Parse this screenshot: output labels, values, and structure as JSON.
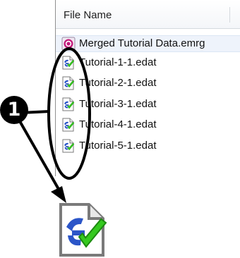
{
  "file_list": {
    "header": "File Name",
    "rows": [
      {
        "name": "Merged Tutorial Data.emrg",
        "icon": "merged-data-icon"
      },
      {
        "name": "Tutorial-1-1.edat",
        "icon": "edat-file-icon"
      },
      {
        "name": "Tutorial-2-1.edat",
        "icon": "edat-file-icon"
      },
      {
        "name": "Tutorial-3-1.edat",
        "icon": "edat-file-icon"
      },
      {
        "name": "Tutorial-4-1.edat",
        "icon": "edat-file-icon"
      },
      {
        "name": "Tutorial-5-1.edat",
        "icon": "edat-file-icon"
      }
    ]
  },
  "callout": {
    "number": "1"
  },
  "enlarged_icon": "edat-file-icon",
  "colors": {
    "callout": "#000000",
    "icon_blue": "#2b55c8",
    "icon_check": "#35c91f",
    "merged_icon": "#c2187a"
  }
}
